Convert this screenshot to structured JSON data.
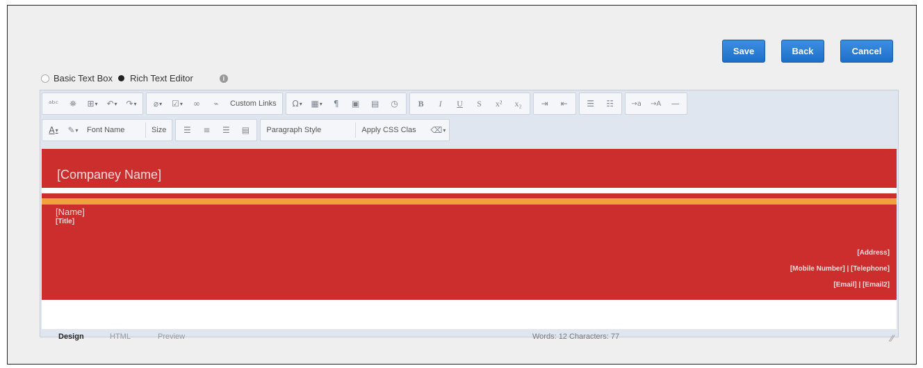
{
  "actions": {
    "save": "Save",
    "back": "Back",
    "cancel": "Cancel"
  },
  "mode": {
    "basic": "Basic Text Box",
    "rich": "Rich Text Editor",
    "info_icon": "info-icon"
  },
  "toolbar1": {
    "custom_links": "Custom Links",
    "icons": [
      "spellcheck",
      "find",
      "insert",
      "undo",
      "redo",
      "attach",
      "image",
      "link",
      "unlink",
      "special-char",
      "table",
      "paragraph-mark",
      "media",
      "calendar",
      "clock",
      "bold",
      "italic",
      "underline",
      "strike",
      "superscript",
      "subscript",
      "indent",
      "outdent",
      "ordered-list",
      "unordered-list",
      "ltr",
      "rtl",
      "horizontal-rule"
    ]
  },
  "toolbar2": {
    "font_name": "Font Name",
    "size": "Size",
    "paragraph_style": "Paragraph Style",
    "apply_css": "Apply CSS Clas"
  },
  "content": {
    "company": "[Companey Name]",
    "name": "[Name]",
    "title": "[Title]",
    "address": "[Address]",
    "phones": "[Mobile Number] | [Telephone]",
    "emails": "[Email] | [Email2]",
    "colors": {
      "red": "#cc2e2e",
      "orange": "#f1a33a"
    }
  },
  "footer": {
    "tabs": [
      "Design",
      "HTML",
      "Preview"
    ],
    "words": "Words: 12",
    "characters": "Characters: 77"
  }
}
